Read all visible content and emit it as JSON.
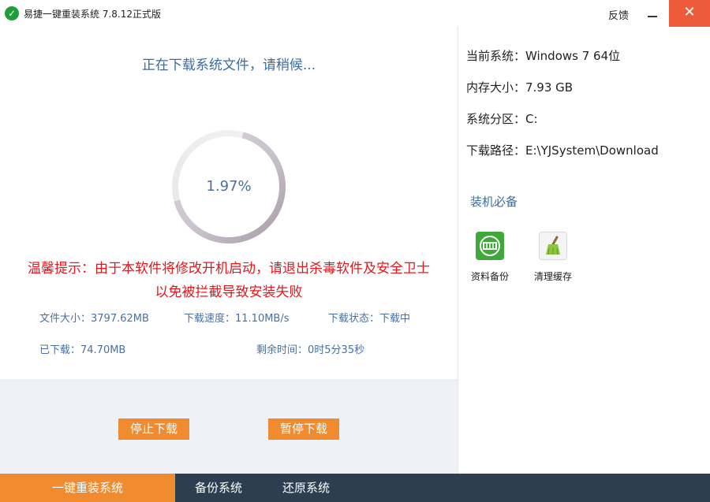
{
  "window": {
    "title": "易捷一键重装系统 7.8.12正式版",
    "feedback_label": "反馈",
    "close_glyph": "✕"
  },
  "download": {
    "heading": "正在下载系统文件，请稍候...",
    "progress_text": "1.97%",
    "progress_fraction": 0.0197,
    "warning_line1": "温馨提示：由于本软件将修改开机启动，请退出杀毒软件及安全卫士",
    "warning_line2": "以免被拦截导致安装失败",
    "file_size": "文件大小：3797.62MB",
    "speed": "下载速度：11.10MB/s",
    "state": "下载状态：下载中",
    "downloaded": "已下载：74.70MB",
    "remaining": "剩余时间：0时5分35秒"
  },
  "actions": {
    "stop_label": "停止下载",
    "pause_label": "暂停下载"
  },
  "system_info": {
    "current_system": "当前系统：Windows 7 64位",
    "memory": "内存大小：7.93 GB",
    "partition": "系统分区：C:",
    "download_path": "下载路径：E:\\YJSystem\\Download"
  },
  "tools": {
    "section_title": "装机必备",
    "items": [
      {
        "label": "资料备份",
        "icon": "data-backup-icon"
      },
      {
        "label": "清理缓存",
        "icon": "broom-clean-icon"
      }
    ]
  },
  "nav": {
    "tabs": [
      {
        "label": "一键重装系统",
        "active": true
      },
      {
        "label": "备份系统",
        "active": false
      },
      {
        "label": "还原系统",
        "active": false
      }
    ]
  },
  "colors": {
    "accent_orange": "#f08c2f",
    "close_red": "#ee5b3a",
    "heading_blue": "#3e6aa1",
    "warning_red": "#e8161b",
    "nav_dark": "#2c3e50"
  }
}
